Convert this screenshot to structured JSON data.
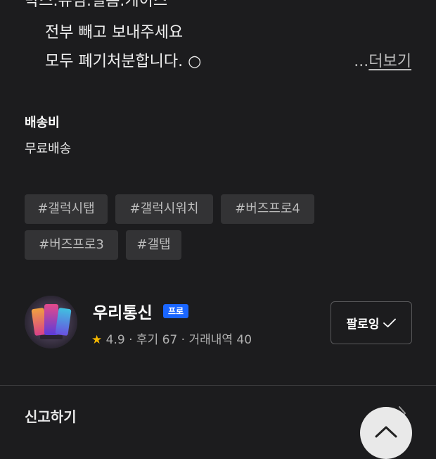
{
  "description": {
    "lines": [
      "박스.유심.필름.케이스",
      "전부 빼고 보내주세요",
      "모두 폐기처분합니다. ○"
    ],
    "more_ellipsis": "...",
    "more_label": "더보기"
  },
  "shipping": {
    "title": "배송비",
    "value": "무료배송"
  },
  "tags": [
    "#갤럭시탭",
    "#갤럭시워치",
    "#버즈프로4",
    "#버즈프로3",
    "#갤탭"
  ],
  "seller": {
    "name": "우리통신",
    "badge": "프로",
    "rating": "4.9",
    "reviews": "후기 67",
    "trades": "거래내역 40",
    "separator": "·",
    "follow_label": "팔로잉"
  },
  "footer": {
    "report_label": "신고하기"
  },
  "icons": {
    "star": "star-icon",
    "check": "check-icon",
    "chevron_right": "chevron-right-icon",
    "chevron_up": "chevron-up-icon"
  },
  "colors": {
    "background": "#1c1c1e",
    "badge": "#1a66ff",
    "star": "#f5b800",
    "tag_bg": "#333335"
  }
}
